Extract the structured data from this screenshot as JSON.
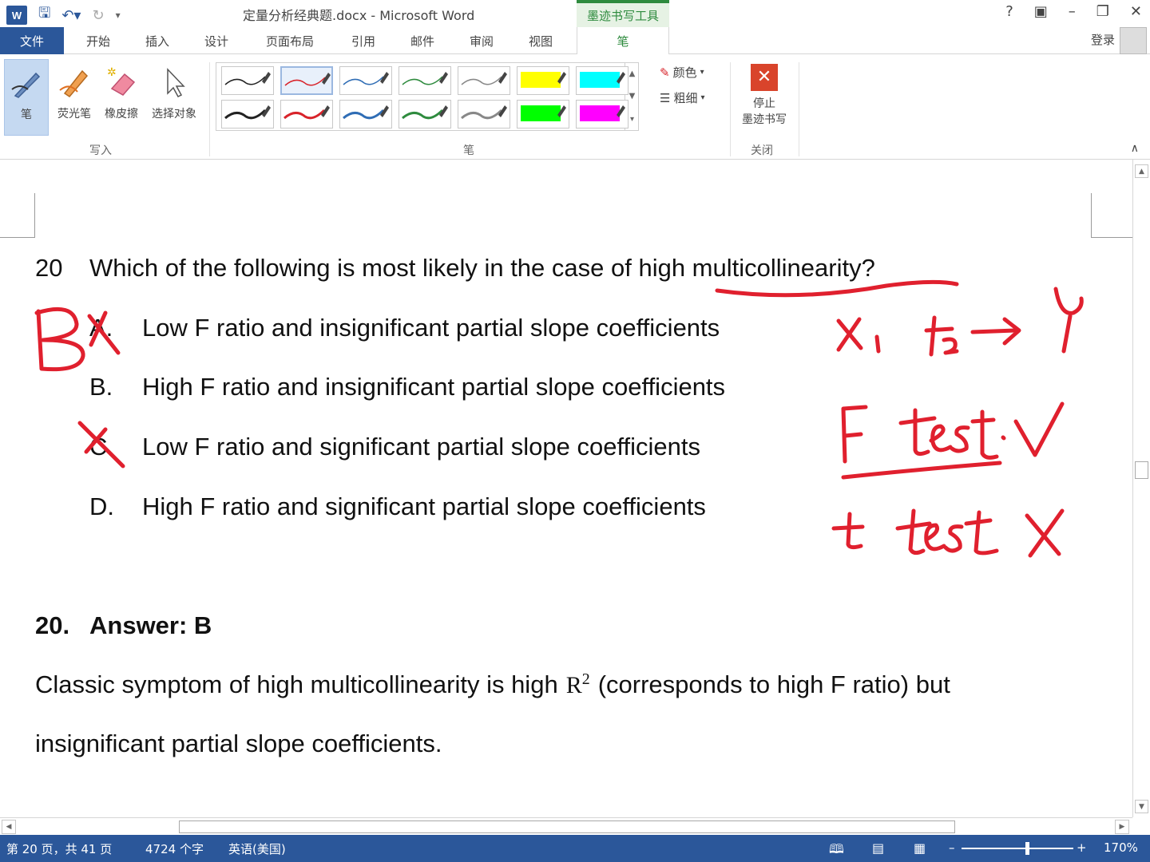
{
  "window": {
    "title": "定量分析经典题.docx - Microsoft Word",
    "context_tab": "墨迹书写工具",
    "help": "?",
    "login": "登录"
  },
  "tabs": [
    "文件",
    "开始",
    "插入",
    "设计",
    "页面布局",
    "引用",
    "邮件",
    "审阅",
    "视图",
    "笔"
  ],
  "ribbon": {
    "tools": [
      "笔",
      "荧光笔",
      "橡皮擦",
      "选择对象"
    ],
    "group_write": "写入",
    "group_pens": "笔",
    "color_label": "颜色",
    "thickness_label": "粗细",
    "stop_label_1": "停止",
    "stop_label_2": "墨迹书写",
    "group_close": "关闭",
    "pen_colors": [
      "#222222",
      "#d8232a",
      "#2f6db5",
      "#2e8b3e",
      "#888888",
      "#ffff00",
      "#00ffff",
      "#222222",
      "#d8232a",
      "#2f6db5",
      "#2e8b3e",
      "#888888",
      "#00ff00",
      "#ff00ff"
    ]
  },
  "document": {
    "question": {
      "number": "20",
      "text": "Which of the following is most likely in the case of high multicollinearity?",
      "options": [
        {
          "letter": "A.",
          "text": "Low F ratio and insignificant partial slope coefficients"
        },
        {
          "letter": "B.",
          "text": "High F ratio and insignificant partial slope coefficients"
        },
        {
          "letter": "C.",
          "text": "Low F ratio and significant partial slope coefficients"
        },
        {
          "letter": "D.",
          "text": "High F ratio and significant partial slope coefficients"
        }
      ]
    },
    "answer": {
      "number": "20.",
      "label": "Answer: B",
      "line1_before": "Classic symptom of high multicollinearity is high",
      "r_symbol": "R",
      "r_power": "2",
      "line1_after": "(corresponds to high F ratio) but",
      "line2": "insignificant partial slope coefficients."
    }
  },
  "status": {
    "page": "第 20 页，共 41 页",
    "words": "4724 个字",
    "language": "英语(美国)",
    "zoom": "170%"
  }
}
